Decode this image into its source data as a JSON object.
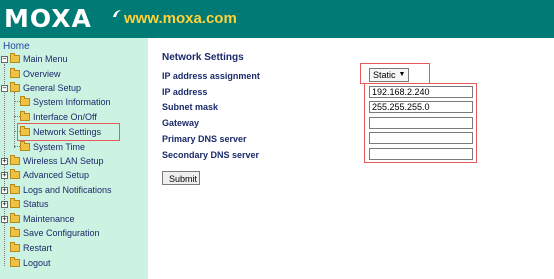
{
  "header": {
    "logo_text": "MOXA",
    "website": "www.moxa.com",
    "logo_color": "#ffffff",
    "website_color": "#ffd23a",
    "background": "#007a74"
  },
  "sidebar": {
    "home_label": "Home",
    "background": "#ccf2e2",
    "main_menu": "Main Menu",
    "items": {
      "overview": "Overview",
      "general_setup": "General Setup",
      "system_information": "System Information",
      "interface_onoff": "Interface On/Off",
      "network_settings": "Network Settings",
      "system_time": "System Time",
      "wireless_lan_setup": "Wireless LAN Setup",
      "advanced_setup": "Advanced Setup",
      "logs_notifications": "Logs and Notifications",
      "status": "Status",
      "maintenance": "Maintenance",
      "save_configuration": "Save Configuration",
      "restart": "Restart",
      "logout": "Logout"
    },
    "expander_plus": "+",
    "expander_minus": "−"
  },
  "main": {
    "title": "Network Settings",
    "fields": {
      "ip_assignment_label": "IP address assignment",
      "ip_assignment_value": "Static",
      "ip_address_label": "IP address",
      "ip_address_value": "192.168.2.240",
      "subnet_mask_label": "Subnet mask",
      "subnet_mask_value": "255.255.255.0",
      "gateway_label": "Gateway",
      "gateway_value": "",
      "primary_dns_label": "Primary DNS server",
      "primary_dns_value": "",
      "secondary_dns_label": "Secondary DNS server",
      "secondary_dns_value": ""
    },
    "submit_label": "Submit"
  },
  "colors": {
    "highlight": "#e85a5a",
    "label_text": "#1a2a6a"
  }
}
